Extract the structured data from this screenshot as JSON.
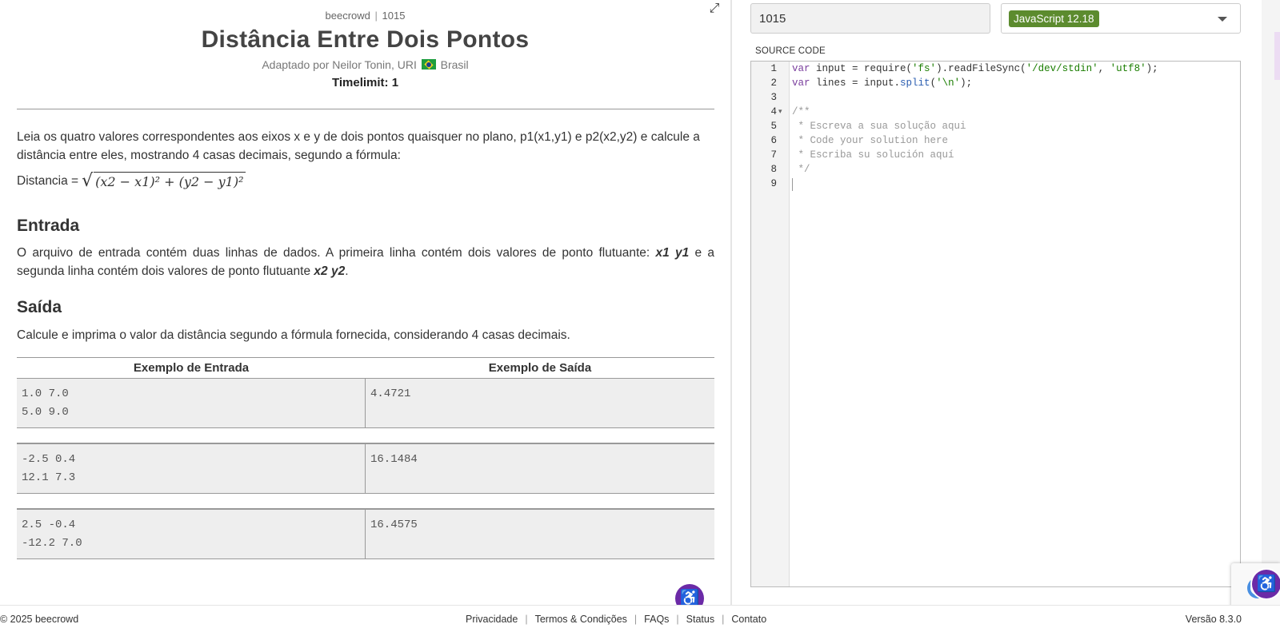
{
  "problem": {
    "site": "beecrowd",
    "id": "1015",
    "title": "Distância Entre Dois Pontos",
    "author_prefix": "Adaptado por Neilor Tonin, URI",
    "author_country": "Brasil",
    "timelimit": "Timelimit: 1"
  },
  "description": {
    "text": "Leia os quatro valores correspondentes aos eixos x e y de dois pontos quaisquer no plano, p1(x1,y1) e p2(x2,y2) e calcule a distância entre eles, mostrando 4 casas decimais, segundo a fórmula:",
    "formula_label": "Distancia =",
    "formula_expr": "(x2 − x1)² + (y2 − y1)²"
  },
  "input_section": {
    "heading": "Entrada",
    "text_1": "O arquivo de entrada contém duas linhas de dados. A primeira linha contém dois valores de ponto flutuante: ",
    "bold_1": "x1 y1",
    "text_2": " e a segunda linha contém dois valores de ponto flutuante ",
    "bold_2": "x2 y2",
    "text_3": "."
  },
  "output_section": {
    "heading": "Saída",
    "text": "Calcule e imprima o valor da distância segundo a fórmula fornecida, considerando 4 casas decimais."
  },
  "samples": {
    "input_header": "Exemplo de Entrada",
    "output_header": "Exemplo de Saída",
    "rows": [
      {
        "input": "1.0 7.0\n5.0 9.0",
        "output": "4.4721"
      },
      {
        "input": "-2.5 0.4\n12.1 7.3",
        "output": "16.1484"
      },
      {
        "input": "2.5 -0.4\n-12.2 7.0",
        "output": "16.4575"
      }
    ]
  },
  "editor": {
    "problem_id_value": "1015",
    "language": "JavaScript 12.18",
    "source_label": "SOURCE CODE",
    "line_numbers": [
      "1",
      "2",
      "3",
      "4",
      "5",
      "6",
      "7",
      "8",
      "9"
    ]
  },
  "footer": {
    "copyright": "© 2025 beecrowd",
    "links": [
      "Privacidade",
      "Termos & Condições",
      "FAQs",
      "Status",
      "Contato"
    ],
    "version": "Versão 8.3.0"
  },
  "icons": {
    "expand": "expand-icon",
    "accessibility": "accessibility-icon",
    "recaptcha": "recaptcha-icon",
    "dropdown": "chevron-down-icon"
  },
  "colors": {
    "language_badge": "#5c8b2e",
    "accessibility": "#6b2aa7",
    "sample_bg": "#eeeeee"
  }
}
